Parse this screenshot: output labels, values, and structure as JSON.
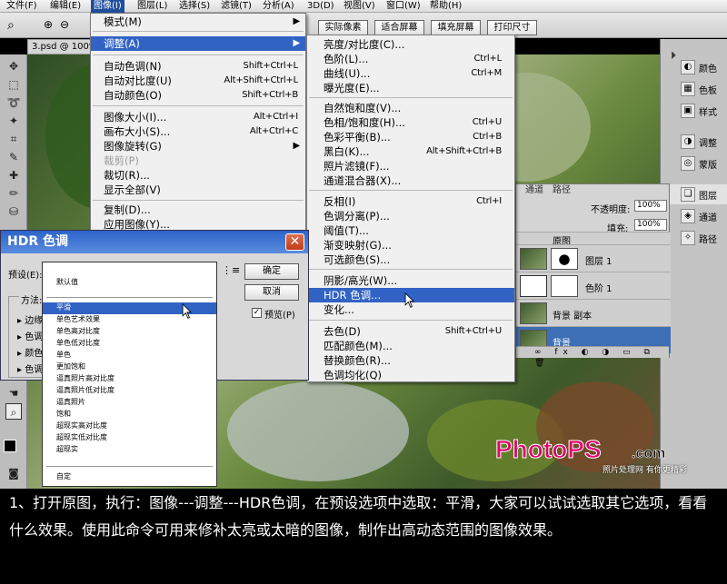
{
  "menubar": {
    "items": [
      "文件(F)",
      "编辑(E)",
      "图像(I)",
      "图层(L)",
      "选择(S)",
      "滤镜(T)",
      "分析(A)",
      "3D(D)",
      "视图(V)",
      "窗口(W)",
      "帮助(H)"
    ]
  },
  "options_bar": {
    "buttons": [
      "实际像素",
      "适合屏幕",
      "填充屏幕",
      "打印尺寸"
    ]
  },
  "document_tab": "3.psd @ 100%",
  "image_menu": {
    "items": [
      {
        "label": "模式(M)",
        "shortcut": "",
        "submenu": true
      },
      {
        "label": "调整(A)",
        "shortcut": "",
        "submenu": true,
        "highlighted": true
      },
      {
        "label": "自动色调(N)",
        "shortcut": "Shift+Ctrl+L"
      },
      {
        "label": "自动对比度(U)",
        "shortcut": "Alt+Shift+Ctrl+L"
      },
      {
        "label": "自动颜色(O)",
        "shortcut": "Shift+Ctrl+B"
      },
      {
        "label": "图像大小(I)...",
        "shortcut": "Alt+Ctrl+I"
      },
      {
        "label": "画布大小(S)...",
        "shortcut": "Alt+Ctrl+C"
      },
      {
        "label": "图像旋转(G)",
        "shortcut": "",
        "submenu": true
      },
      {
        "label": "裁剪(P)",
        "shortcut": "",
        "disabled": true
      },
      {
        "label": "裁切(R)...",
        "shortcut": ""
      },
      {
        "label": "显示全部(V)",
        "shortcut": ""
      },
      {
        "label": "复制(D)...",
        "shortcut": ""
      },
      {
        "label": "应用图像(Y)...",
        "shortcut": ""
      }
    ]
  },
  "adjust_menu": {
    "items": [
      {
        "label": "亮度/对比度(C)...",
        "shortcut": ""
      },
      {
        "label": "色阶(L)...",
        "shortcut": "Ctrl+L"
      },
      {
        "label": "曲线(U)...",
        "shortcut": "Ctrl+M"
      },
      {
        "label": "曝光度(E)...",
        "shortcut": ""
      },
      {
        "label": "自然饱和度(V)...",
        "shortcut": ""
      },
      {
        "label": "色相/饱和度(H)...",
        "shortcut": "Ctrl+U"
      },
      {
        "label": "色彩平衡(B)...",
        "shortcut": "Ctrl+B"
      },
      {
        "label": "黑白(K)...",
        "shortcut": "Alt+Shift+Ctrl+B"
      },
      {
        "label": "照片滤镜(F)...",
        "shortcut": ""
      },
      {
        "label": "通道混合器(X)...",
        "shortcut": ""
      },
      {
        "label": "反相(I)",
        "shortcut": "Ctrl+I"
      },
      {
        "label": "色调分离(P)...",
        "shortcut": ""
      },
      {
        "label": "阈值(T)...",
        "shortcut": ""
      },
      {
        "label": "渐变映射(G)...",
        "shortcut": ""
      },
      {
        "label": "可选颜色(S)...",
        "shortcut": ""
      },
      {
        "label": "阴影/高光(W)...",
        "shortcut": ""
      },
      {
        "label": "HDR 色调...",
        "shortcut": "",
        "highlighted": true
      },
      {
        "label": "变化...",
        "shortcut": ""
      },
      {
        "label": "去色(D)",
        "shortcut": "Shift+Ctrl+U"
      },
      {
        "label": "匹配颜色(M)...",
        "shortcut": ""
      },
      {
        "label": "替换颜色(R)...",
        "shortcut": ""
      },
      {
        "label": "色调均化(Q)",
        "shortcut": ""
      }
    ]
  },
  "dialog": {
    "title": "HDR 色调",
    "preset_label": "预设(E):",
    "preset_value": "平滑",
    "method_label": "方法:",
    "ok": "确定",
    "cancel": "取消",
    "preview": "预览(P)",
    "preview_checked": true,
    "group_rows": [
      "边缘",
      "色调",
      "颜色",
      "色调"
    ],
    "dropdown_options": [
      "默认值",
      "平滑",
      "单色艺术效果",
      "单色高对比度",
      "单色低对比度",
      "单色",
      "更加饱和",
      "逼真照片高对比度",
      "逼真照片低对比度",
      "逼真照片",
      "饱和",
      "超现实高对比度",
      "超现实低对比度",
      "超现实",
      "自定"
    ],
    "dropdown_selected": "平滑"
  },
  "layers_panel": {
    "tabs": [
      "通道",
      "路径"
    ],
    "opacity_label": "不透明度:",
    "opacity_value": "100%",
    "fill_label": "填充:",
    "fill_value": "100%",
    "layers": [
      {
        "name": "原图",
        "selected": false
      },
      {
        "name": "图层 1",
        "selected": false
      },
      {
        "name": "色阶 1",
        "selected": false
      },
      {
        "name": "背景 副本",
        "selected": false
      },
      {
        "name": "背景",
        "selected": true
      }
    ]
  },
  "right_dock": {
    "items": [
      "颜色",
      "色板",
      "样式",
      "调整",
      "蒙版",
      "图层",
      "通道",
      "路径"
    ]
  },
  "watermark": {
    "logo": "PhotoPS.com",
    "tagline": "照片处理网 有你更精彩"
  },
  "caption": "1、打开原图，执行：图像---调整---HDR色调，在预设选项中选取：平滑，大家可以试试选取其它选项，看看什么效果。使用此命令可用来修补太亮或太暗的图像，制作出高动态范围的图像效果。"
}
